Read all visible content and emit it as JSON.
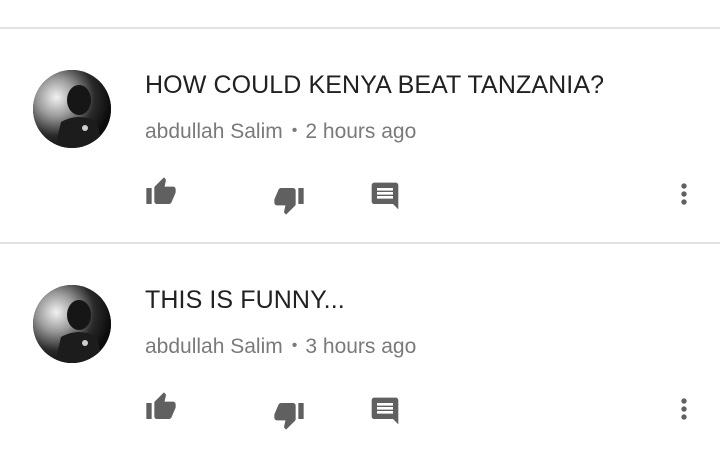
{
  "comments": [
    {
      "text": "HOW COULD KENYA BEAT TANZANIA?",
      "author": "abdullah Salim",
      "separator": "•",
      "time": "2 hours ago",
      "actions": [
        "like-icon",
        "dislike-icon",
        "reply-icon",
        "more-vert-icon"
      ]
    },
    {
      "text": "THIS IS FUNNY...",
      "author": "abdullah Salim",
      "separator": "•",
      "time": "3 hours ago",
      "actions": [
        "like-icon",
        "dislike-icon",
        "reply-icon",
        "more-vert-icon"
      ]
    }
  ],
  "colors": {
    "text": "#212121",
    "meta": "#7a7a7a",
    "icon": "#606060",
    "divider": "#e2e2e2"
  }
}
